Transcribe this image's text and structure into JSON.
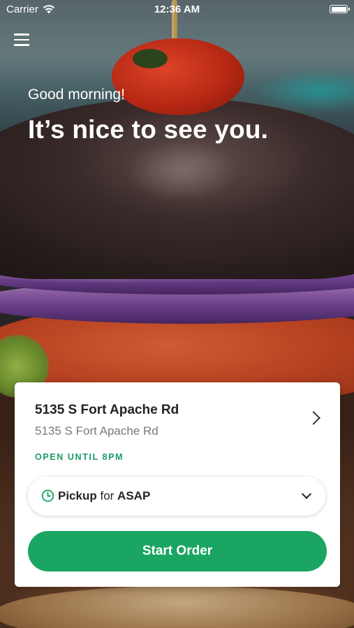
{
  "status_bar": {
    "carrier": "Carrier",
    "time": "12:36 AM"
  },
  "header": {
    "greeting": "Good morning!",
    "headline": "It’s nice to see you."
  },
  "store": {
    "name": "5135 S Fort Apache Rd",
    "address": "5135 S Fort Apache Rd",
    "hours": "OPEN UNTIL 8PM"
  },
  "order_mode": {
    "mode": "Pickup",
    "connector": " for ",
    "time": "ASAP"
  },
  "actions": {
    "start_order": "Start Order"
  },
  "colors": {
    "accent": "#1aa563",
    "hours_text": "#1a9b62"
  },
  "icons": {
    "menu": "hamburger-menu-icon",
    "wifi": "wifi-icon",
    "battery": "battery-icon",
    "chevron_right": "chevron-right-icon",
    "clock": "clock-icon",
    "chevron_down": "chevron-down-icon"
  }
}
